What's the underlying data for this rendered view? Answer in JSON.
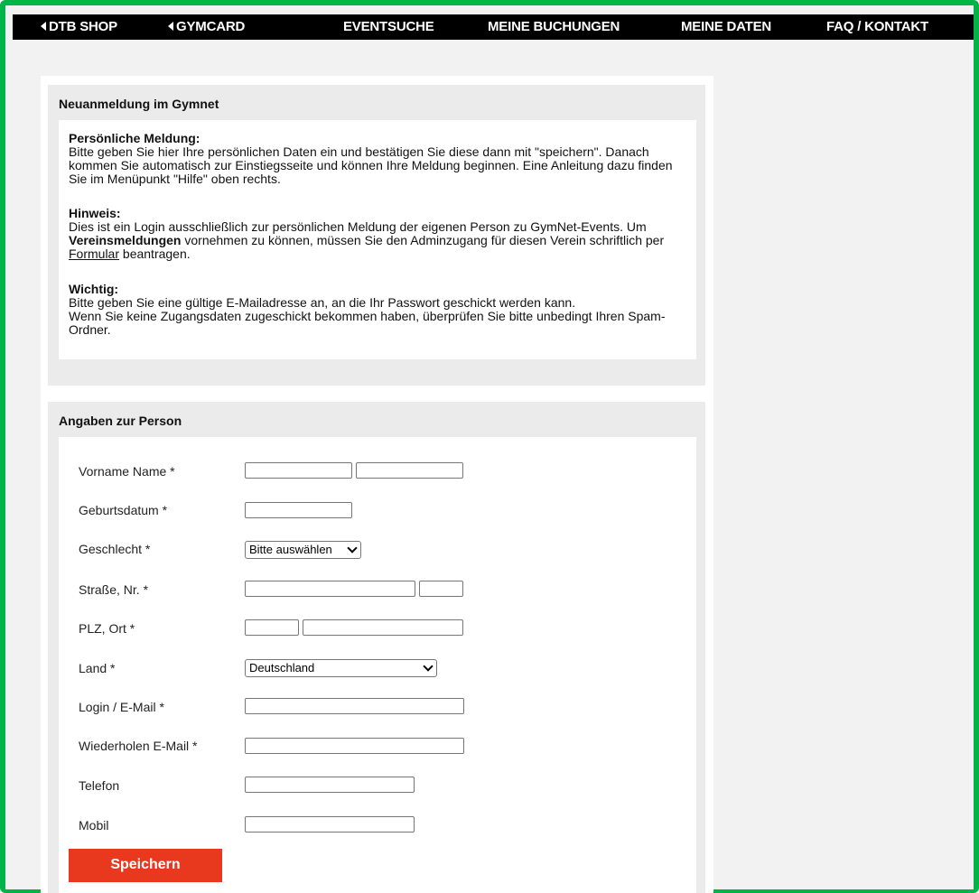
{
  "nav": {
    "dtb_shop": "DTB SHOP",
    "gymcard": "GYMCARD",
    "eventsuche": "EVENTSUCHE",
    "meine_buchungen": "MEINE BUCHUNGEN",
    "meine_daten": "MEINE DATEN",
    "faq": "FAQ / KONTAKT"
  },
  "info_panel": {
    "title": "Neuanmeldung im Gymnet",
    "personal": {
      "heading": "Persönliche Meldung:",
      "text": "Bitte geben Sie hier Ihre persönlichen Daten ein und bestätigen Sie diese dann mit \"speichern\". Danach kommen Sie automatisch zur Einstiegsseite und können Ihre Meldung beginnen. Eine Anleitung dazu finden Sie im Menüpunkt \"Hilfe\" oben rechts."
    },
    "hint": {
      "heading": "Hinweis:",
      "text_1": "Dies ist ein Login ausschließlich zur persönlichen Meldung der eigenen Person zu GymNet-Events. Um ",
      "bold": "Vereinsmeldungen",
      "text_2": " vornehmen zu können, müssen Sie den Adminzugang für diesen Verein schriftlich per ",
      "link": "Formular",
      "text_3": " beantragen."
    },
    "important": {
      "heading": "Wichtig:",
      "line_1": "Bitte geben Sie eine gültige E-Mailadresse an, an die Ihr Passwort geschickt werden kann.",
      "line_2": "Wenn Sie keine Zugangsdaten zugeschickt bekommen haben, überprüfen Sie bitte unbedingt Ihren Spam-Ordner."
    }
  },
  "form_panel": {
    "title": "Angaben zur Person",
    "labels": {
      "name": "Vorname Name *",
      "birthdate": "Geburtsdatum *",
      "gender": "Geschlecht *",
      "street": "Straße, Nr. *",
      "zip_city": "PLZ, Ort *",
      "country": "Land *",
      "login": "Login / E-Mail *",
      "repeat_email": "Wiederholen E-Mail *",
      "phone": "Telefon",
      "mobile": "Mobil"
    },
    "gender_selected": "Bitte auswählen",
    "country_selected": "Deutschland",
    "save_label": "Speichern"
  }
}
